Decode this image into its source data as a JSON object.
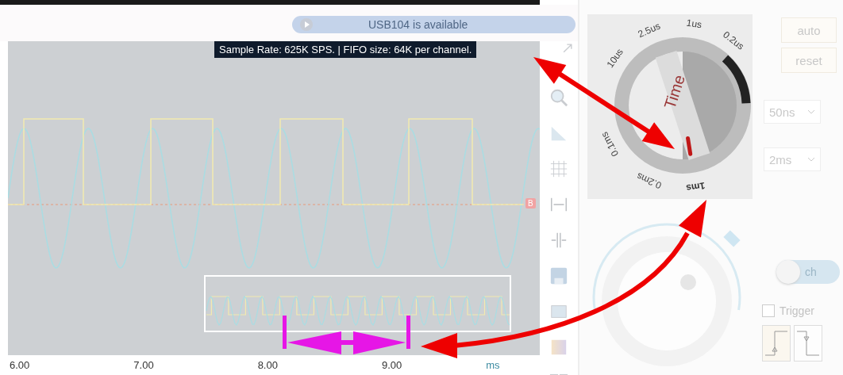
{
  "status": {
    "text": "USB104 is available"
  },
  "plot": {
    "tooltip": "Sample Rate: 625K SPS. | FIFO size: 64K per channel.",
    "marker": "B",
    "x_ticks": [
      "6.00",
      "7.00",
      "8.00",
      "9.00"
    ],
    "unit": "ms"
  },
  "time_dial": {
    "title": "Time",
    "labels": [
      {
        "text": "0.2us",
        "selected": false
      },
      {
        "text": "1us",
        "selected": false
      },
      {
        "text": "2.5us",
        "selected": false
      },
      {
        "text": "10us",
        "selected": false
      },
      {
        "text": "0.1ms",
        "selected": false
      },
      {
        "text": "0.2ms",
        "selected": false
      },
      {
        "text": "1ms",
        "selected": true
      }
    ]
  },
  "buttons": [
    "auto",
    "reset"
  ],
  "selects": [
    "50ns",
    "2ms"
  ],
  "toggle": {
    "label": "ch",
    "on": false
  },
  "trigger": {
    "label": "Trigger",
    "checked": false
  }
}
